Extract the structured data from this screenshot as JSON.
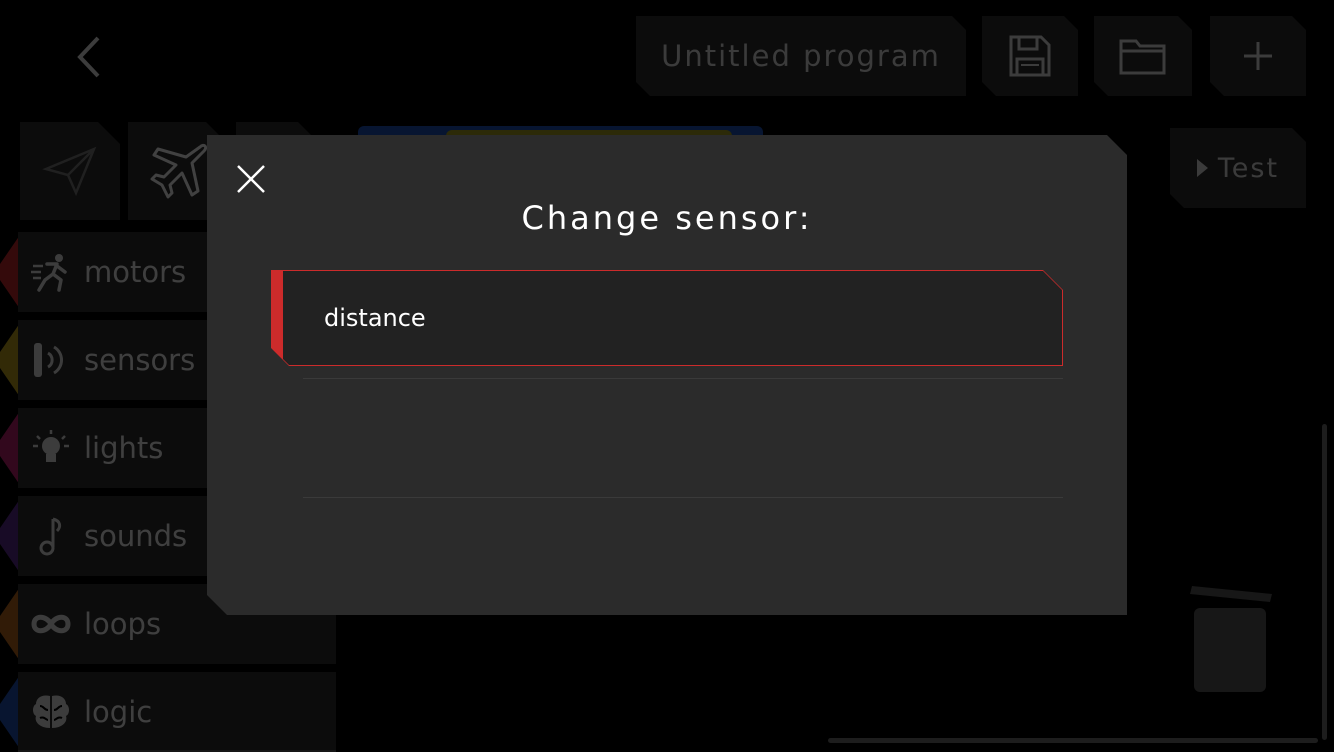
{
  "header": {
    "program_title": "Untitled program",
    "save_label": "",
    "open_label": "",
    "new_label": ""
  },
  "test_button": {
    "label": "Test"
  },
  "categories": [
    {
      "label": "motors",
      "color": "#c0262b",
      "icon": "running-icon"
    },
    {
      "label": "sensors",
      "color": "#b89a1c",
      "icon": "sensor-icon"
    },
    {
      "label": "lights",
      "color": "#b8216a",
      "icon": "lightbulb-icon"
    },
    {
      "label": "sounds",
      "color": "#5a2a8a",
      "icon": "music-note-icon"
    },
    {
      "label": "loops",
      "color": "#b5651d",
      "icon": "loop-icon"
    },
    {
      "label": "logic",
      "color": "#1e4fb0",
      "icon": "brain-icon"
    }
  ],
  "modal": {
    "title": "Change sensor:",
    "options": [
      {
        "label": "distance",
        "selected": true
      }
    ],
    "accent_color": "#cc2b2b"
  }
}
